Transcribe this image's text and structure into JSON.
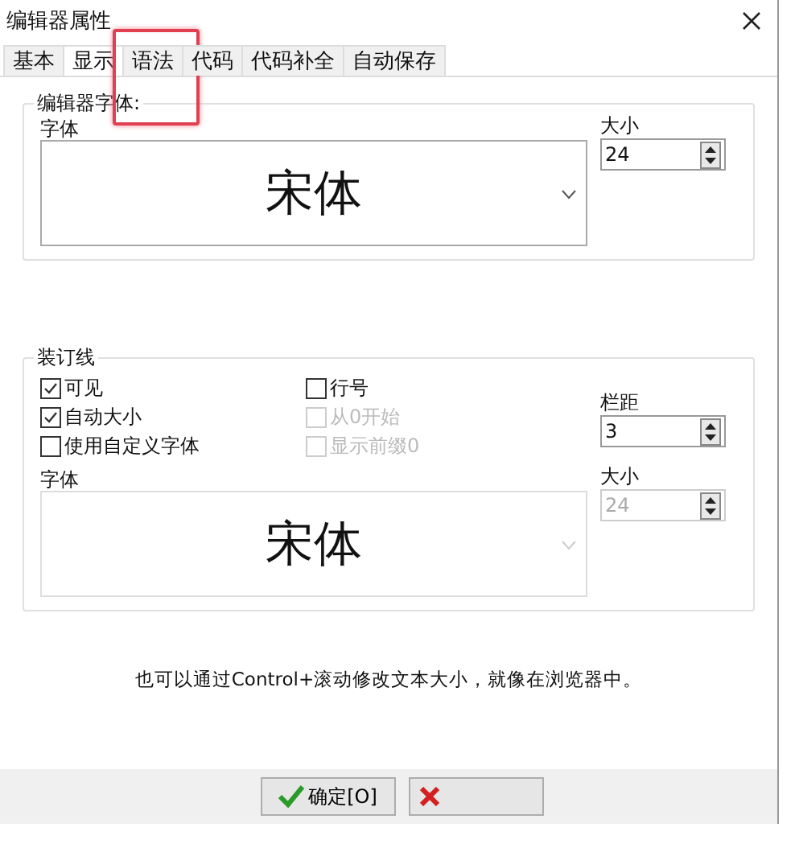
{
  "window": {
    "title": "编辑器属性"
  },
  "tabs": [
    {
      "label": "基本",
      "selected": false,
      "highlighted": false
    },
    {
      "label": "显示",
      "selected": true,
      "highlighted": false
    },
    {
      "label": "语法",
      "selected": false,
      "highlighted": true
    },
    {
      "label": "代码",
      "selected": false,
      "highlighted": false
    },
    {
      "label": "代码补全",
      "selected": false,
      "highlighted": false
    },
    {
      "label": "自动保存",
      "selected": false,
      "highlighted": false
    }
  ],
  "editor_font": {
    "title": "编辑器字体:",
    "font_label": "字体",
    "font": "宋体",
    "size_label": "大小",
    "size": "24"
  },
  "gutter": {
    "title": "装订线",
    "options_left": [
      {
        "label": "可见",
        "checked": true,
        "disabled": false
      },
      {
        "label": "自动大小",
        "checked": true,
        "disabled": false
      },
      {
        "label": "使用自定义字体",
        "checked": false,
        "disabled": false
      }
    ],
    "options_right": [
      {
        "label": "行号",
        "checked": false,
        "disabled": false
      },
      {
        "label": "从0开始",
        "checked": false,
        "disabled": true
      },
      {
        "label": "显示前缀0",
        "checked": false,
        "disabled": true
      }
    ],
    "spacing_label": "栏距",
    "spacing": "3",
    "font_label": "字体",
    "font": "宋体",
    "size_label": "大小",
    "size": "24",
    "font_disabled": true
  },
  "hint": "也可以通过Control+滚动修改文本大小，就像在浏览器中。",
  "buttons": [
    {
      "kind": "ok",
      "label": "确定[O]"
    },
    {
      "kind": "cancel"
    }
  ]
}
